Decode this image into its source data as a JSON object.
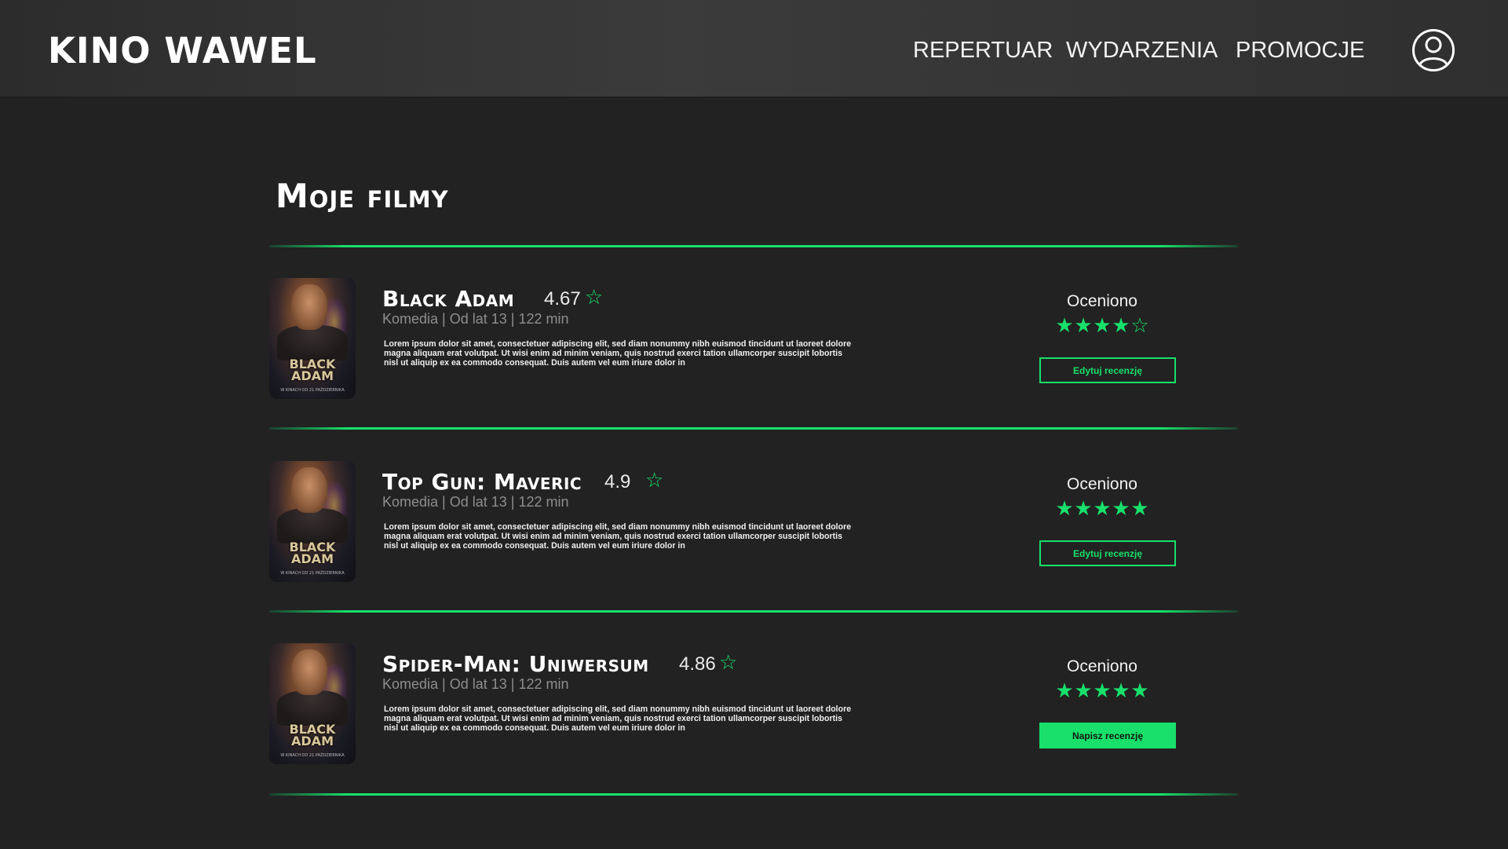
{
  "header": {
    "brand": "KINO WAWEL",
    "nav": [
      "REPERTUAR",
      "WYDARZENIA",
      "PROMOCJE"
    ],
    "user_icon": "user-circle-icon"
  },
  "page": {
    "title": "Moje filmy"
  },
  "colors": {
    "accent": "#18e06a",
    "background": "#222222",
    "header": "#353535"
  },
  "movies": [
    {
      "title": "Black Adam",
      "rating": "4.67",
      "meta": "Komedia | Od lat 13 | 122 min",
      "description": "Lorem ipsum dolor sit amet, consectetuer adipiscing elit, sed diam nonummy nibh euismod tincidunt ut laoreet dolore magna aliquam erat volutpat. Ut wisi enim ad minim veniam, quis nostrud exerci tation ullamcorper suscipit lobortis nisl ut aliquip ex ea commodo consequat. Duis autem vel eum iriure dolor in",
      "rated_label": "Oceniono",
      "user_stars": 4,
      "max_stars": 5,
      "button_label": "Edytuj recenzję",
      "button_style": "outline",
      "poster": {
        "title_line1": "BLACK",
        "title_line2": "ADAM",
        "sub": "W KINACH OD 21 PAŹDZIERNIKA"
      }
    },
    {
      "title": "Top Gun: Maveric",
      "rating": "4.9",
      "meta": "Komedia | Od lat 13 | 122 min",
      "description": "Lorem ipsum dolor sit amet, consectetuer adipiscing elit, sed diam nonummy nibh euismod tincidunt ut laoreet dolore magna aliquam erat volutpat. Ut wisi enim ad minim veniam, quis nostrud exerci tation ullamcorper suscipit lobortis nisl ut aliquip ex ea commodo consequat. Duis autem vel eum iriure dolor in",
      "rated_label": "Oceniono",
      "user_stars": 5,
      "max_stars": 5,
      "button_label": "Edytuj recenzję",
      "button_style": "outline",
      "poster": {
        "title_line1": "BLACK",
        "title_line2": "ADAM",
        "sub": "W KINACH OD 21 PAŹDZIERNIKA"
      }
    },
    {
      "title": "Spider-Man: Uniwersum",
      "rating": "4.86",
      "meta": "Komedia | Od lat 13 | 122 min",
      "description": "Lorem ipsum dolor sit amet, consectetuer adipiscing elit, sed diam nonummy nibh euismod tincidunt ut laoreet dolore magna aliquam erat volutpat. Ut wisi enim ad minim veniam, quis nostrud exerci tation ullamcorper suscipit lobortis nisl ut aliquip ex ea commodo consequat. Duis autem vel eum iriure dolor in",
      "rated_label": "Oceniono",
      "user_stars": 5,
      "max_stars": 5,
      "button_label": "Napisz recenzję",
      "button_style": "filled",
      "poster": {
        "title_line1": "BLACK",
        "title_line2": "ADAM",
        "sub": "W KINACH OD 21 PAŹDZIERNIKA"
      }
    }
  ]
}
